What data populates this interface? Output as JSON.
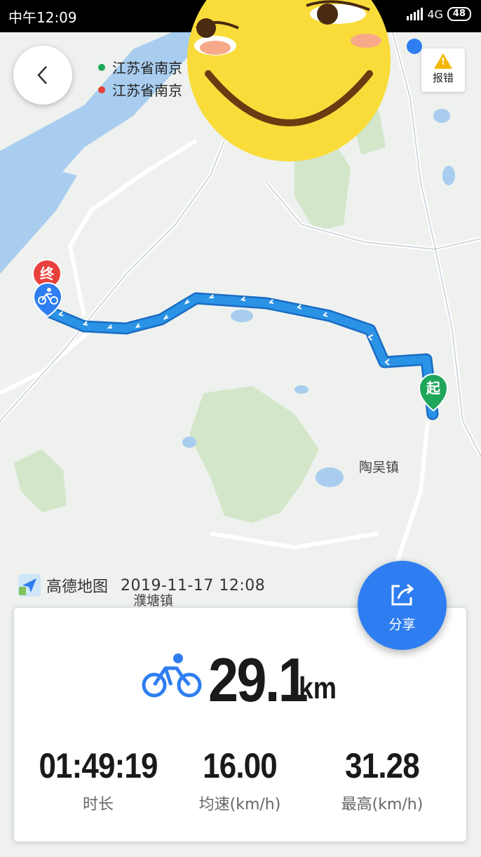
{
  "status_bar": {
    "time": "中午12:09",
    "network": "4G",
    "battery": "48"
  },
  "locations": {
    "start": "江苏省南京",
    "end": "江苏省南京"
  },
  "report_label": "报错",
  "map_labels": {
    "start_marker": "起",
    "end_marker": "终",
    "town1": "陶吴镇",
    "town2": "濮塘镇"
  },
  "brand": {
    "name": "高德地图",
    "datetime": "2019-11-17  12:08"
  },
  "share_label": "分享",
  "ride": {
    "distance": "29.1",
    "distance_unit": "km",
    "stats": [
      {
        "value": "01:49:19",
        "label": "时长"
      },
      {
        "value": "16.00",
        "label": "均速(km/h)"
      },
      {
        "value": "31.28",
        "label": "最高(km/h)"
      }
    ]
  },
  "colors": {
    "accent": "#2f7ef1",
    "route": "#2a93e6",
    "start": "#1ea65a",
    "end": "#e8403a",
    "water": "#a8cdef",
    "green": "#d3e6c9"
  },
  "icons": [
    "back-chevron-icon",
    "warning-icon",
    "share-icon",
    "bicycle-icon",
    "amap-logo-icon"
  ]
}
